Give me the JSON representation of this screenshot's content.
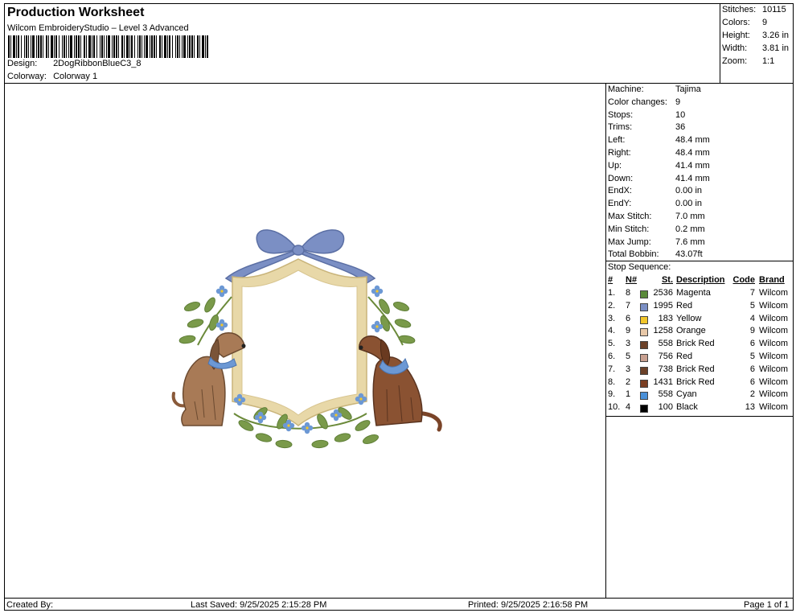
{
  "header": {
    "title": "Production Worksheet",
    "subtitle": "Wilcom EmbroideryStudio – Level 3 Advanced",
    "design_label": "Design:",
    "design_value": "2DogRibbonBlueC3_8",
    "colorway_label": "Colorway:",
    "colorway_value": "Colorway 1"
  },
  "stats": [
    {
      "label": "Stitches:",
      "value": "10115"
    },
    {
      "label": "Colors:",
      "value": "9"
    },
    {
      "label": "Height:",
      "value": "3.26 in"
    },
    {
      "label": "Width:",
      "value": "3.81 in"
    },
    {
      "label": "Zoom:",
      "value": "1:1"
    }
  ],
  "machine_info": [
    {
      "label": "Machine:",
      "value": "Tajima"
    },
    {
      "label": "Color changes:",
      "value": "9"
    },
    {
      "label": "Stops:",
      "value": "10"
    },
    {
      "label": "Trims:",
      "value": "36"
    },
    {
      "label": "Left:",
      "value": "48.4 mm"
    },
    {
      "label": "Right:",
      "value": "48.4 mm"
    },
    {
      "label": "Up:",
      "value": "41.4 mm"
    },
    {
      "label": "Down:",
      "value": "41.4 mm"
    },
    {
      "label": "EndX:",
      "value": "0.00 in"
    },
    {
      "label": "EndY:",
      "value": "0.00 in"
    },
    {
      "label": "Max Stitch:",
      "value": "7.0 mm"
    },
    {
      "label": "Min Stitch:",
      "value": "0.2 mm"
    },
    {
      "label": "Max Jump:",
      "value": "7.6 mm"
    },
    {
      "label": "Total Bobbin:",
      "value": "43.07ft"
    }
  ],
  "stop_sequence": {
    "title": "Stop Sequence:",
    "headers": {
      "num": "#",
      "n": "N#",
      "st": "St.",
      "desc": "Description",
      "code": "Code",
      "brand": "Brand"
    },
    "rows": [
      {
        "num": "1.",
        "n": "8",
        "color": "#5a8a3a",
        "st": "2536",
        "desc": "Magenta",
        "code": "7",
        "brand": "Wilcom"
      },
      {
        "num": "2.",
        "n": "7",
        "color": "#7b8fc4",
        "st": "1995",
        "desc": "Red",
        "code": "5",
        "brand": "Wilcom"
      },
      {
        "num": "3.",
        "n": "6",
        "color": "#f2c62a",
        "st": "183",
        "desc": "Yellow",
        "code": "4",
        "brand": "Wilcom"
      },
      {
        "num": "4.",
        "n": "9",
        "color": "#e8c8a8",
        "st": "1258",
        "desc": "Orange",
        "code": "9",
        "brand": "Wilcom"
      },
      {
        "num": "5.",
        "n": "3",
        "color": "#6b4028",
        "st": "558",
        "desc": "Brick Red",
        "code": "6",
        "brand": "Wilcom"
      },
      {
        "num": "6.",
        "n": "5",
        "color": "#c8a090",
        "st": "756",
        "desc": "Red",
        "code": "5",
        "brand": "Wilcom"
      },
      {
        "num": "7.",
        "n": "3",
        "color": "#6b4028",
        "st": "738",
        "desc": "Brick Red",
        "code": "6",
        "brand": "Wilcom"
      },
      {
        "num": "8.",
        "n": "2",
        "color": "#7a3e22",
        "st": "1431",
        "desc": "Brick Red",
        "code": "6",
        "brand": "Wilcom"
      },
      {
        "num": "9.",
        "n": "1",
        "color": "#4a90d8",
        "st": "558",
        "desc": "Cyan",
        "code": "2",
        "brand": "Wilcom"
      },
      {
        "num": "10.",
        "n": "4",
        "color": "#000000",
        "st": "100",
        "desc": "Black",
        "code": "13",
        "brand": "Wilcom"
      }
    ]
  },
  "footer": {
    "created_by": "Created By:",
    "last_saved": "Last Saved: 9/25/2025 2:15:28 PM",
    "printed": "Printed: 9/25/2025 2:16:58 PM",
    "page": "Page 1 of 1"
  }
}
